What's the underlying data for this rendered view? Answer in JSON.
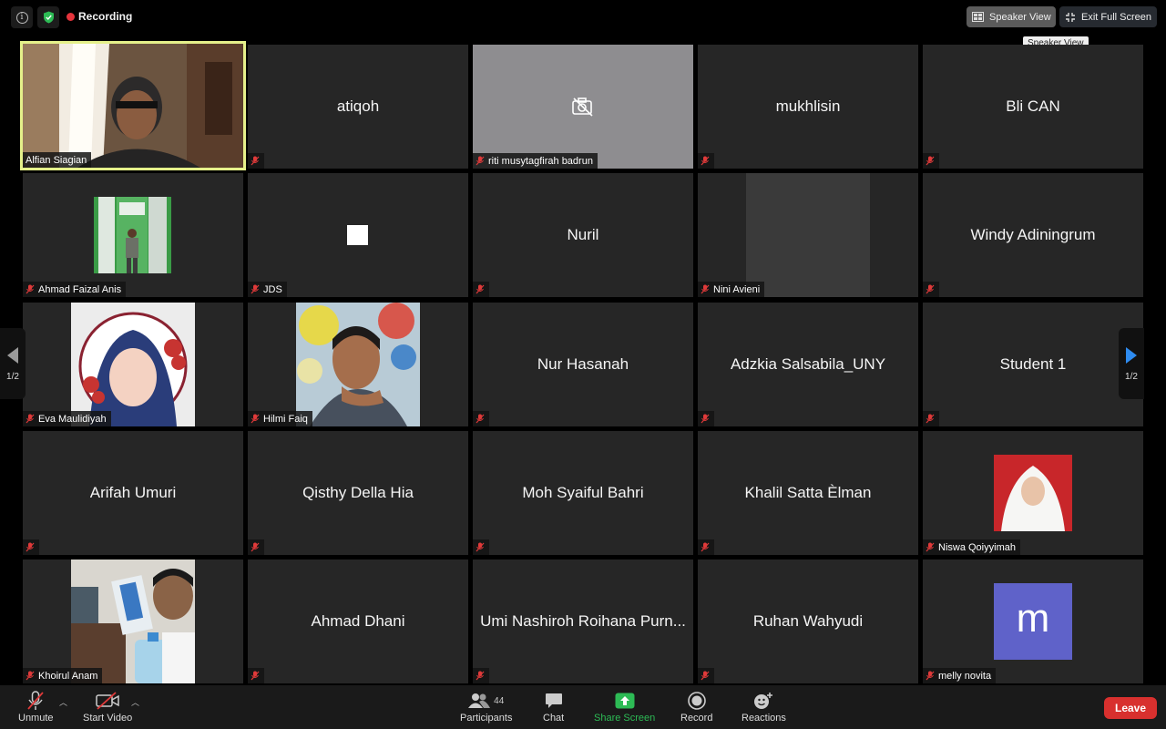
{
  "topbar": {
    "recording_label": "Recording",
    "speaker_view_label": "Speaker View",
    "exit_fullscreen_label": "Exit Full Screen",
    "tooltip": "Speaker View"
  },
  "pager": {
    "left_label": "1/2",
    "right_label": "1/2"
  },
  "participants": [
    {
      "name": "Alfian Siagian",
      "video": true
    },
    {
      "name": "atiqoh",
      "video": false
    },
    {
      "name": "riti musytagfirah badrun",
      "video": false
    },
    {
      "name": "mukhlisin",
      "video": false
    },
    {
      "name": "Bli CAN",
      "video": false
    },
    {
      "name": "Ahmad Faizal Anis",
      "video": true
    },
    {
      "name": "JDS",
      "video": true
    },
    {
      "name": "Nuril",
      "video": false
    },
    {
      "name": "Nini Avieni",
      "video": true
    },
    {
      "name": "Windy Adiningrum",
      "video": false
    },
    {
      "name": "Eva Maulidiyah",
      "video": true
    },
    {
      "name": "Hilmi Faiq",
      "video": true
    },
    {
      "name": "Nur Hasanah",
      "video": false
    },
    {
      "name": "Adzkia Salsabila_UNY",
      "video": false
    },
    {
      "name": "Student 1",
      "video": false
    },
    {
      "name": "Arifah Umuri",
      "video": false
    },
    {
      "name": "Qisthy Della Hia",
      "video": false
    },
    {
      "name": "Moh Syaiful Bahri",
      "video": false
    },
    {
      "name": "Khalil Satta Èlman",
      "video": false
    },
    {
      "name": "Niswa Qoiyyimah",
      "video": true
    },
    {
      "name": "Khoirul Anam",
      "video": true
    },
    {
      "name": "Ahmad Dhani",
      "video": false
    },
    {
      "name": "Umi Nashiroh Roihana Purn...",
      "video": false
    },
    {
      "name": "Ruhan Wahyudi",
      "video": false
    },
    {
      "name": "melly novita",
      "video": true,
      "avatar_letter": "m"
    }
  ],
  "toolbar": {
    "unmute_label": "Unmute",
    "start_video_label": "Start Video",
    "participants_label": "Participants",
    "participants_count": "44",
    "chat_label": "Chat",
    "share_label": "Share Screen",
    "record_label": "Record",
    "reactions_label": "Reactions",
    "leave_label": "Leave"
  },
  "colors": {
    "active_speaker_border": "#e5f08a",
    "share_green": "#2dbb55",
    "leave_red": "#d8302e",
    "recording_red": "#e5343c",
    "avatar_purple": "#5f62c9"
  }
}
